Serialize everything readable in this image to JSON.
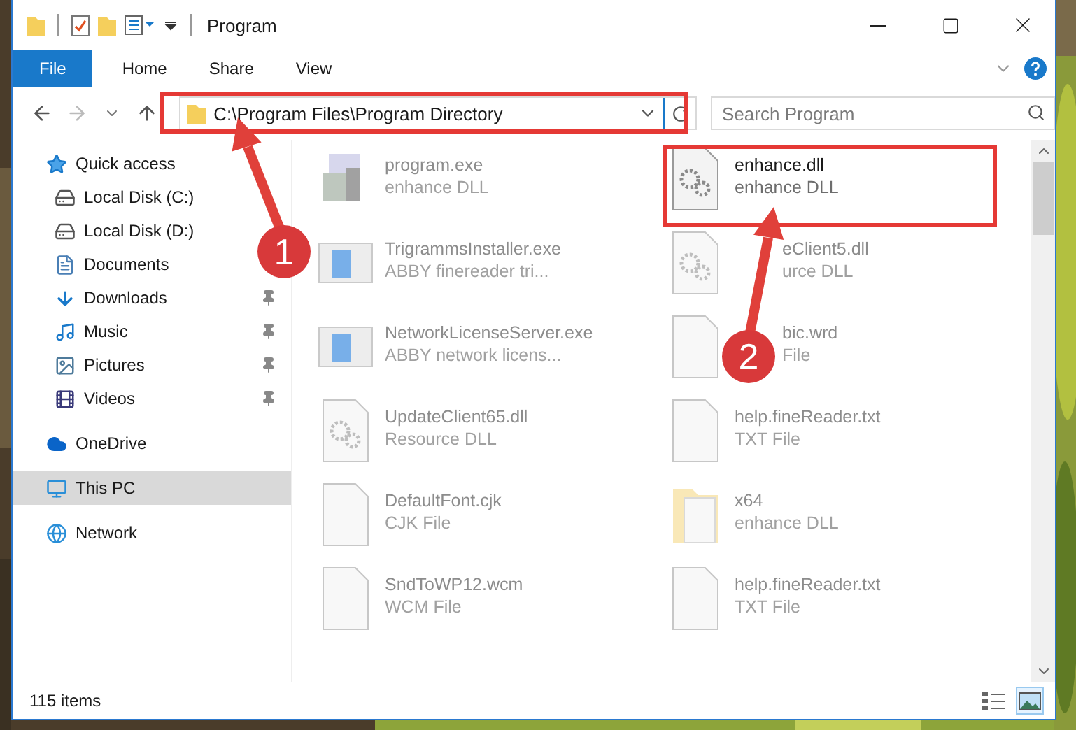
{
  "window": {
    "title": "Program"
  },
  "ribbon": {
    "tabs": [
      {
        "label": "File",
        "kind": "menu"
      },
      {
        "label": "Home",
        "kind": "tab"
      },
      {
        "label": "Share",
        "kind": "tab"
      },
      {
        "label": "View",
        "kind": "tab"
      }
    ]
  },
  "address": {
    "path": "C:\\Program Files\\Program Directory"
  },
  "search": {
    "placeholder": "Search Program"
  },
  "sidebar": {
    "items": [
      {
        "label": "Quick access",
        "kind": "star",
        "selected": false,
        "children": [
          {
            "label": "Local Disk (C:)",
            "kind": "drive",
            "selected": false,
            "pinned": false
          },
          {
            "label": "Local Disk (D:)",
            "kind": "drive",
            "selected": false,
            "pinned": false
          },
          {
            "label": "Documents",
            "kind": "documents",
            "selected": false,
            "pinned": false
          },
          {
            "label": "Downloads",
            "kind": "downloads",
            "selected": false,
            "pinned": true
          },
          {
            "label": "Music",
            "kind": "music",
            "selected": false,
            "pinned": true
          },
          {
            "label": "Pictures",
            "kind": "pictures",
            "selected": false,
            "pinned": true
          },
          {
            "label": "Videos",
            "kind": "videos",
            "selected": false,
            "pinned": true
          }
        ]
      },
      {
        "label": "OneDrive",
        "kind": "cloud",
        "selected": false
      },
      {
        "label": "This PC",
        "kind": "pc",
        "selected": true
      },
      {
        "label": "Network",
        "kind": "network",
        "selected": false
      }
    ]
  },
  "files": [
    {
      "name": "program.exe",
      "type": "enhance DLL",
      "kind": "installer",
      "dimmed": true
    },
    {
      "name": "enhance.dll",
      "type": "enhance DLL",
      "kind": "dll",
      "dimmed": false
    },
    {
      "name": "TrigrammsInstaller.exe",
      "type": "ABBY finereader tri...",
      "kind": "app",
      "dimmed": true
    },
    {
      "name": "eClient5.dll",
      "type": "urce DLL",
      "kind": "dll",
      "dimmed": true,
      "covered": true
    },
    {
      "name": "NetworkLicenseServer.exe",
      "type": "ABBY network licens...",
      "kind": "app",
      "dimmed": true
    },
    {
      "name": "bic.wrd",
      "type": "File",
      "kind": "doc",
      "dimmed": true,
      "covered": true
    },
    {
      "name": "UpdateClient65.dll",
      "type": "Resource DLL",
      "kind": "dll",
      "dimmed": true
    },
    {
      "name": "help.fineReader.txt",
      "type": "TXT File",
      "kind": "doc",
      "dimmed": true
    },
    {
      "name": "DefaultFont.cjk",
      "type": "CJK File",
      "kind": "doc",
      "dimmed": true
    },
    {
      "name": "x64",
      "type": "enhance DLL",
      "kind": "folder",
      "dimmed": true
    },
    {
      "name": "SndToWP12.wcm",
      "type": "WCM File",
      "kind": "doc",
      "dimmed": true
    },
    {
      "name": "help.fineReader.txt",
      "type": "TXT File",
      "kind": "doc",
      "dimmed": true
    }
  ],
  "status_bar": {
    "count": "115 items",
    "views": [
      {
        "kind": "details",
        "selected": false
      },
      {
        "kind": "large-icons",
        "selected": true
      }
    ]
  },
  "annotations": [
    {
      "number": "1"
    },
    {
      "number": "2"
    }
  ]
}
